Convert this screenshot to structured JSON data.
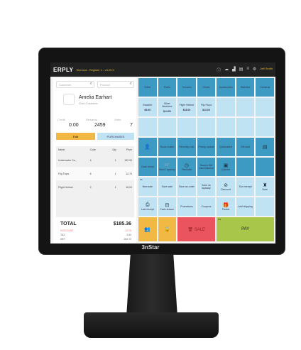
{
  "device": {
    "brand": "3nStar"
  },
  "header": {
    "logo": "ERPLY",
    "subtitle": "Workout - Register 1 - v3.20.0",
    "user": "Jeff Smith",
    "icons": [
      "info-icon",
      "cloud-icon",
      "signal-icon",
      "calendar-icon",
      "menu-icon",
      "gear-icon"
    ]
  },
  "search": {
    "customer_placeholder": "Customer",
    "product_placeholder": "Product"
  },
  "customer": {
    "name": "Amelia Earhart",
    "group": "Gold Customer",
    "stats": [
      {
        "label": "Credit",
        "value": "0.00"
      },
      {
        "label": "Rewards",
        "value": "2459"
      },
      {
        "label": "Visits",
        "value": "7"
      }
    ],
    "edit_label": "Edit",
    "purchases_label": "PURCHASES"
  },
  "cart": {
    "columns": [
      "Name",
      "Code",
      "Qty",
      "Price"
    ],
    "rows": [
      {
        "name": "Underwater Ca...",
        "code": "4",
        "qty": "1",
        "price": "152.00"
      },
      {
        "name": "Flip Flops",
        "code": "6",
        "qty": "1",
        "price": "12.74"
      },
      {
        "name": "Flight Helmet",
        "code": "2",
        "qty": "1",
        "price": "18.00"
      }
    ]
  },
  "totals": {
    "total_label": "TOTAL",
    "total": "$185.36",
    "discount_label": "DISCOUNT",
    "discount": "-12.25",
    "tax_label": "TAX",
    "tax": "2.84",
    "net_label": "NET",
    "net": "182.72"
  },
  "tiles": {
    "categories": [
      "Shirts",
      "Pants",
      "Trousers",
      "Shoes",
      "Accessories",
      "Watches",
      "Cameras"
    ],
    "products": [
      {
        "name": "Bracelet",
        "price": "$9.00"
      },
      {
        "name": "Silver Necklace",
        "price": "$14.90"
      },
      {
        "name": "Flight Helmet",
        "price": "$18.00"
      },
      {
        "name": "Flip Flops",
        "price": "$13.00"
      }
    ],
    "functions1": [
      "Round sales",
      "Recently sold",
      "Pricing update",
      "Quickselect",
      "Gift card"
    ],
    "functions2": [
      "Cash in/out",
      "Save Layaway",
      "Find sale",
      "Search Gift Card balance",
      "Queues"
    ],
    "sales": [
      "New sale",
      "Save sale",
      "Save as order",
      "Save as layaway",
      "Discount",
      "Tax exempt",
      "Note"
    ],
    "extras": [
      "Last receipt",
      "Cash drawer",
      "Promotions",
      "Coupons",
      "Packet",
      "Add shipping"
    ],
    "new_sale_key": "F6",
    "pay_key": "F9",
    "sale_label": "SALE",
    "pay_label": "PAY"
  },
  "colors": {
    "dark_tile": "#3d9ac2",
    "light_tile": "#bfe3f2",
    "sale": "#e9545f",
    "pay": "#a7c64a",
    "action": "#f1b944"
  }
}
